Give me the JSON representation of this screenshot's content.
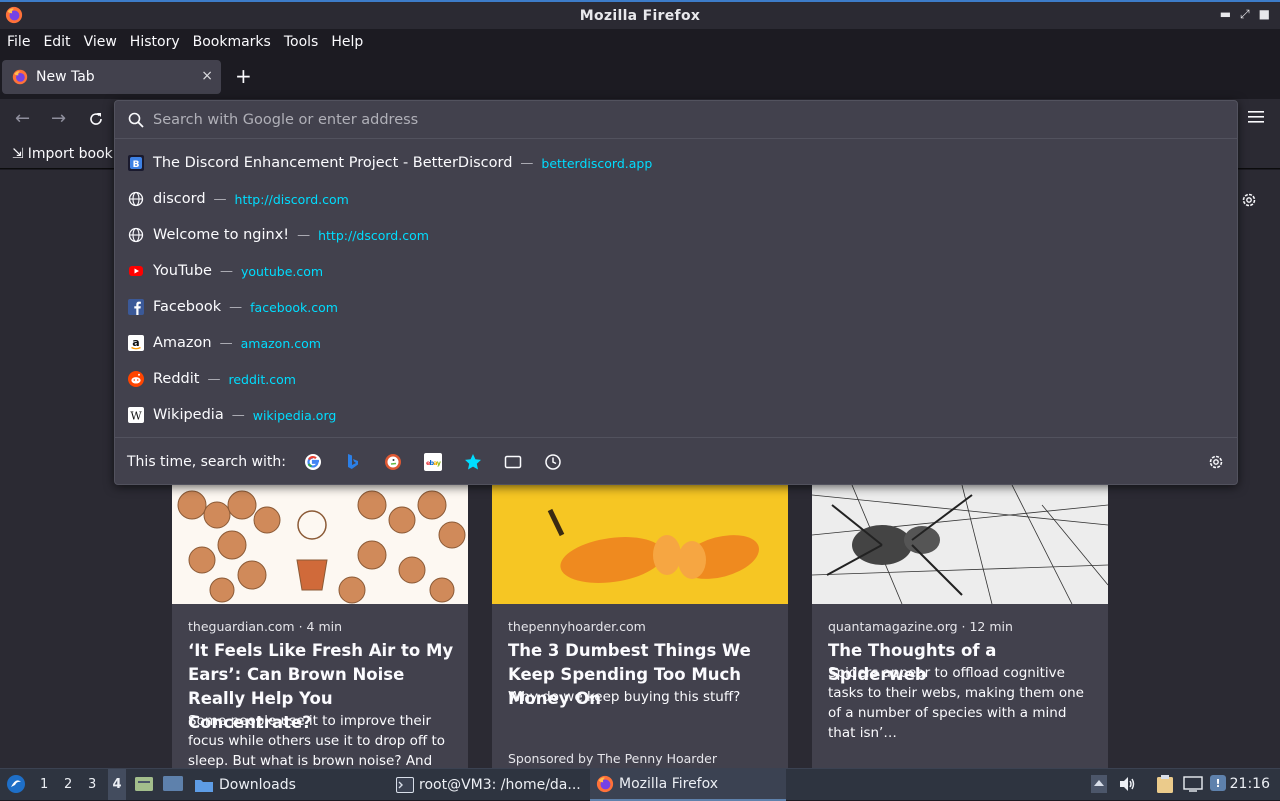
{
  "window": {
    "title": "Mozilla Firefox"
  },
  "menu": [
    "File",
    "Edit",
    "View",
    "History",
    "Bookmarks",
    "Tools",
    "Help"
  ],
  "tab": {
    "label": "New Tab",
    "close": "×",
    "new_tab": "+"
  },
  "bookmarks_toolbar": {
    "import_label": "Import book"
  },
  "urlbar": {
    "placeholder": "Search with Google or enter address",
    "results": [
      {
        "title": "The Discord Enhancement Project - BetterDiscord",
        "url": "betterdiscord.app",
        "icon": "betterdiscord-icon"
      },
      {
        "title": "discord",
        "url": "http://discord.com",
        "icon": "globe-icon"
      },
      {
        "title": "Welcome to nginx!",
        "url": "http://dscord.com",
        "icon": "globe-icon"
      },
      {
        "title": "YouTube",
        "url": "youtube.com",
        "icon": "youtube-icon"
      },
      {
        "title": "Facebook",
        "url": "facebook.com",
        "icon": "facebook-icon"
      },
      {
        "title": "Amazon",
        "url": "amazon.com",
        "icon": "amazon-icon"
      },
      {
        "title": "Reddit",
        "url": "reddit.com",
        "icon": "reddit-icon"
      },
      {
        "title": "Wikipedia",
        "url": "wikipedia.org",
        "icon": "wikipedia-icon"
      }
    ],
    "separator": "—",
    "oneoff_label": "This time, search with:"
  },
  "cards": [
    {
      "source": "theguardian.com · 4 min",
      "headline": "‘It Feels Like Fresh Air to My Ears’: Can Brown Noise Really Help You Concentrate?",
      "excerpt": "Some people use it to improve their focus while others use it to drop off to sleep. But what is brown noise? And do…",
      "sponsor": ""
    },
    {
      "source": "thepennyhoarder.com",
      "headline": "The 3 Dumbest Things We Keep Spending Too Much Money On",
      "excerpt": "Why do we keep buying this stuff?",
      "sponsor": "Sponsored by The Penny Hoarder"
    },
    {
      "source": "quantamagazine.org · 12 min",
      "headline": "The Thoughts of a Spiderweb",
      "excerpt": "Spiders appear to offload cognitive tasks to their webs, making them one of a number of species with a mind that isn’…",
      "sponsor": ""
    }
  ],
  "taskbar": {
    "workspaces": [
      "1",
      "2",
      "3",
      "4"
    ],
    "downloads": "Downloads",
    "terminal": "root@VM3: /home/da...",
    "firefox": "Mozilla Firefox",
    "clock": "21:16"
  },
  "colors": {
    "accent_url": "#00ddff",
    "panel": "#42414d",
    "bg": "#2b2a33"
  }
}
